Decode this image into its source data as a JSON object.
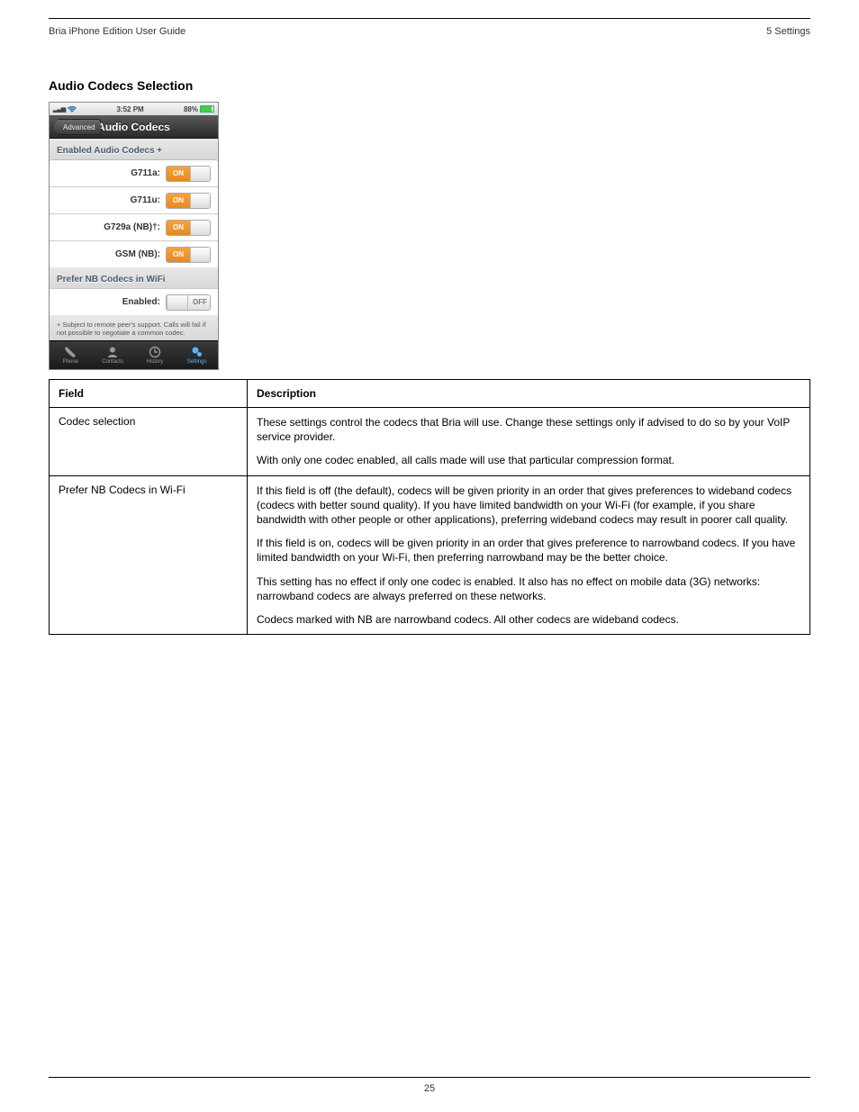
{
  "header": {
    "left": "Bria iPhone Edition User Guide",
    "right": "5  Settings"
  },
  "section_title": "Audio Codecs Selection",
  "phone": {
    "status": {
      "time": "3:52 PM",
      "battery": "88%"
    },
    "nav": {
      "back": "Advanced",
      "title": "Audio Codecs"
    },
    "group1_label": "Enabled Audio Codecs +",
    "codecs": [
      {
        "label": "G711a:",
        "state": "ON"
      },
      {
        "label": "G711u:",
        "state": "ON"
      },
      {
        "label": "G729a (NB)†:",
        "state": "ON"
      },
      {
        "label": "GSM (NB):",
        "state": "ON"
      }
    ],
    "group2_label": "Prefer NB Codecs in WiFi",
    "prefer": {
      "label": "Enabled:",
      "state": "OFF"
    },
    "footnote": "+ Subject to remote peer's support. Calls will fail if not possible to negotiate a common codec.",
    "tabs": [
      {
        "name": "Phone"
      },
      {
        "name": "Contacts"
      },
      {
        "name": "History"
      },
      {
        "name": "Settings"
      }
    ],
    "toggle_on_text": "ON",
    "toggle_off_text": "OFF"
  },
  "table": {
    "head_field": "Field",
    "head_desc": "Description",
    "rows": [
      {
        "field": "Codec selection",
        "paras": [
          "These settings control the codecs that Bria will use. Change these settings only if advised to do so by your VoIP service provider.",
          "With only one codec enabled, all calls made will use that particular compression format."
        ]
      },
      {
        "field": "Prefer NB Codecs in Wi-Fi",
        "paras": [
          "If this field is off (the default), codecs will be given priority in an order that gives preferences to wideband codecs (codecs with better sound quality). If you have limited bandwidth on your Wi-Fi (for example, if you share bandwidth with other people or other applications), preferring wideband codecs may result in poorer call quality.",
          "If this field is on, codecs will be given priority in an order that gives preference to narrowband codecs. If you have limited bandwidth on your Wi-Fi, then preferring narrowband may be the better choice.",
          "This setting has no effect if only one codec is enabled. It also has no effect on mobile data (3G) networks: narrowband codecs are always preferred on these networks.",
          "Codecs marked with NB are narrowband codecs. All other codecs are wideband codecs."
        ]
      }
    ]
  },
  "footer": "25"
}
